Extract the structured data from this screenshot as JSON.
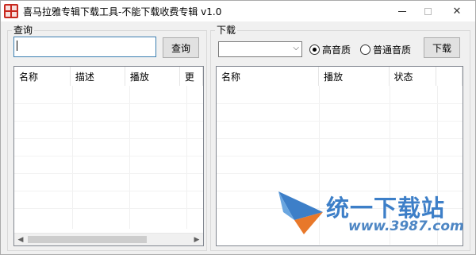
{
  "window": {
    "title": "喜马拉雅专辑下载工具-不能下载收费专辑 v1.0",
    "close_glyph": "✕"
  },
  "query_panel": {
    "group_title": "查询",
    "search_value": "",
    "search_button": "查询",
    "columns": [
      "名称",
      "描述",
      "播放",
      "更"
    ]
  },
  "download_panel": {
    "group_title": "下载",
    "quality_selected": "",
    "radio_high": "高音质",
    "radio_normal": "普通音质",
    "radio_selected": "高音质",
    "download_button": "下载",
    "columns": [
      "名称",
      "播放",
      "状态",
      ""
    ]
  },
  "scrollbar": {
    "left_arrow": "◀",
    "right_arrow": "▶"
  },
  "watermark": {
    "brand": "统一下载站",
    "url": "www.3987.com"
  },
  "colors": {
    "accent": "#3c7fb1",
    "watermark_blue": "#3d7fc8",
    "watermark_orange": "#e8782a",
    "icon_red": "#c8281e"
  }
}
